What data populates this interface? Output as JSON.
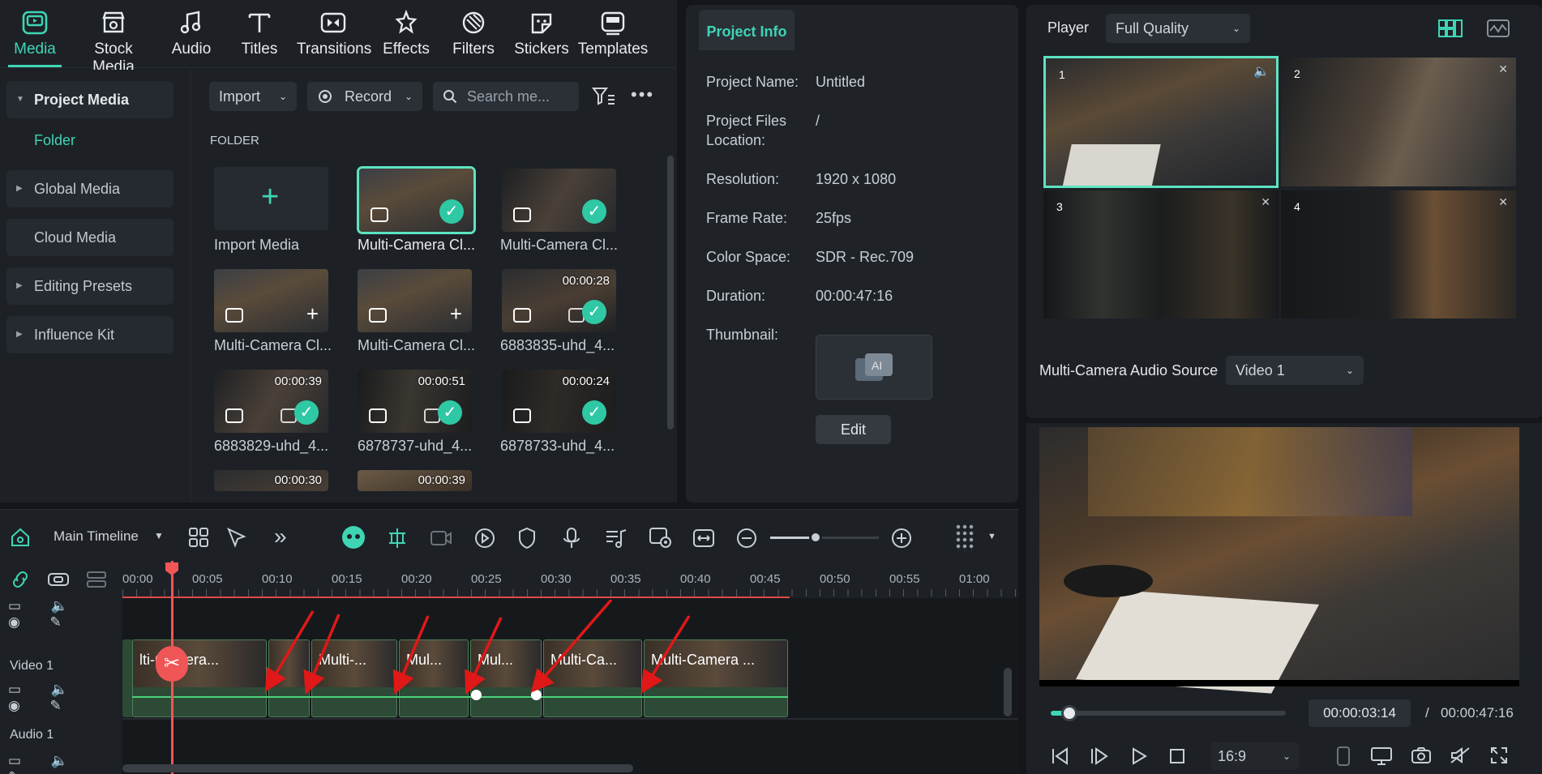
{
  "tabs": [
    {
      "label": "Media",
      "icon": "media-icon"
    },
    {
      "label": "Stock Media",
      "icon": "stock-media-icon"
    },
    {
      "label": "Audio",
      "icon": "audio-icon"
    },
    {
      "label": "Titles",
      "icon": "titles-icon"
    },
    {
      "label": "Transitions",
      "icon": "transitions-icon"
    },
    {
      "label": "Effects",
      "icon": "effects-icon"
    },
    {
      "label": "Filters",
      "icon": "filters-icon"
    },
    {
      "label": "Stickers",
      "icon": "stickers-icon"
    },
    {
      "label": "Templates",
      "icon": "templates-icon"
    }
  ],
  "sidebar": {
    "project_media": "Project Media",
    "folder": "Folder",
    "global_media": "Global Media",
    "cloud_media": "Cloud Media",
    "editing_presets": "Editing Presets",
    "influence_kit": "Influence Kit"
  },
  "toolbar": {
    "import": "Import",
    "record": "Record",
    "search_placeholder": "Search me..."
  },
  "folder_label": "FOLDER",
  "media_items": [
    {
      "label": "Import Media"
    },
    {
      "label": "Multi-Camera Cl...",
      "check": true
    },
    {
      "label": "Multi-Camera Cl...",
      "check": true
    },
    {
      "label": "Multi-Camera Cl...",
      "plus": true
    },
    {
      "label": "Multi-Camera Cl...",
      "plus": true
    },
    {
      "label": "6883835-uhd_4...",
      "duration": "00:00:28",
      "check": true
    },
    {
      "label": "6883829-uhd_4...",
      "duration": "00:00:39",
      "check": true
    },
    {
      "label": "6878737-uhd_4...",
      "duration": "00:00:51",
      "check": true
    },
    {
      "label": "6878733-uhd_4...",
      "duration": "00:00:24",
      "check": true
    },
    {
      "duration": "00:00:30"
    },
    {
      "duration": "00:00:39"
    }
  ],
  "project_info": {
    "tab": "Project Info",
    "name_label": "Project Name:",
    "name": "Untitled",
    "files_label": "Project Files Location:",
    "files": "/",
    "resolution_label": "Resolution:",
    "resolution": "1920 x 1080",
    "frame_rate_label": "Frame Rate:",
    "frame_rate": "25fps",
    "color_space_label": "Color Space:",
    "color_space": "SDR - Rec.709",
    "duration_label": "Duration:",
    "duration": "00:00:47:16",
    "thumbnail_label": "Thumbnail:",
    "edit": "Edit"
  },
  "player": {
    "label": "Player",
    "quality": "Full Quality",
    "cams": [
      "1",
      "2",
      "3",
      "4"
    ],
    "audio_source_label": "Multi-Camera Audio Source",
    "audio_source": "Video 1",
    "current_time": "00:00:03:14",
    "separator": "/",
    "total_time": "00:00:47:16",
    "aspect": "16:9",
    "progress": 0.08
  },
  "timeline": {
    "name": "Main Timeline",
    "ticks": [
      "00:00",
      "00:05",
      "00:10",
      "00:15",
      "00:20",
      "00:25",
      "00:30",
      "00:35",
      "00:40",
      "00:45",
      "00:50",
      "00:55",
      "01:00"
    ],
    "video_track": "Video 1",
    "audio_track": "Audio 1",
    "clips": [
      "lti-Camera...",
      "",
      "Multi-...",
      "Mul...",
      "Mul...",
      "Multi-Ca...",
      "Multi-Camera ..."
    ]
  }
}
